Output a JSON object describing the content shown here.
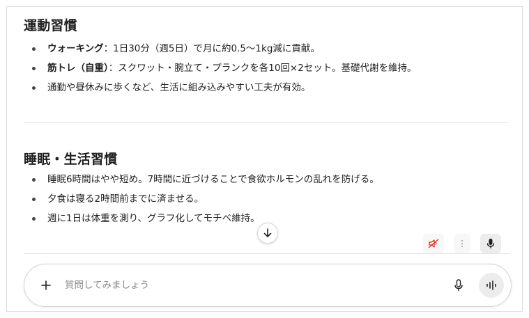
{
  "sections": [
    {
      "title": "運動習慣",
      "items": [
        {
          "bold": "ウォーキング",
          "text": "：1日30分（週5日）で月に約0.5〜1kg減に貢献。"
        },
        {
          "bold": "筋トレ（自重）",
          "text": "：スクワット・腕立て・プランクを各10回×2セット。基礎代謝を維持。"
        },
        {
          "bold": "",
          "text": "通勤や昼休みに歩くなど、生活に組み込みやすい工夫が有効。"
        }
      ]
    },
    {
      "title": "睡眠・生活習慣",
      "items": [
        {
          "bold": "",
          "text": "睡眠6時間はやや短め。7時間に近づけることで食欲ホルモンの乱れを防げる。"
        },
        {
          "bold": "",
          "text": "夕食は寝る2時間前までに済ませる。"
        },
        {
          "bold": "",
          "text": "週に1日は体重を測り、グラフ化してモチベ維持。"
        }
      ]
    }
  ],
  "composer": {
    "placeholder": "質問してみましょう",
    "value": ""
  },
  "icons": {
    "scroll_down": "arrow-down-icon",
    "muted_audio": "speaker-muted-icon",
    "more": "more-vert-icon",
    "dictate": "mic-icon",
    "add": "plus-icon",
    "composer_mic": "mic-icon",
    "voice_mode": "voice-wave-icon"
  },
  "colors": {
    "muted_icon": "#d93025",
    "text": "#1f1f1f",
    "placeholder": "#8a8a8a"
  }
}
